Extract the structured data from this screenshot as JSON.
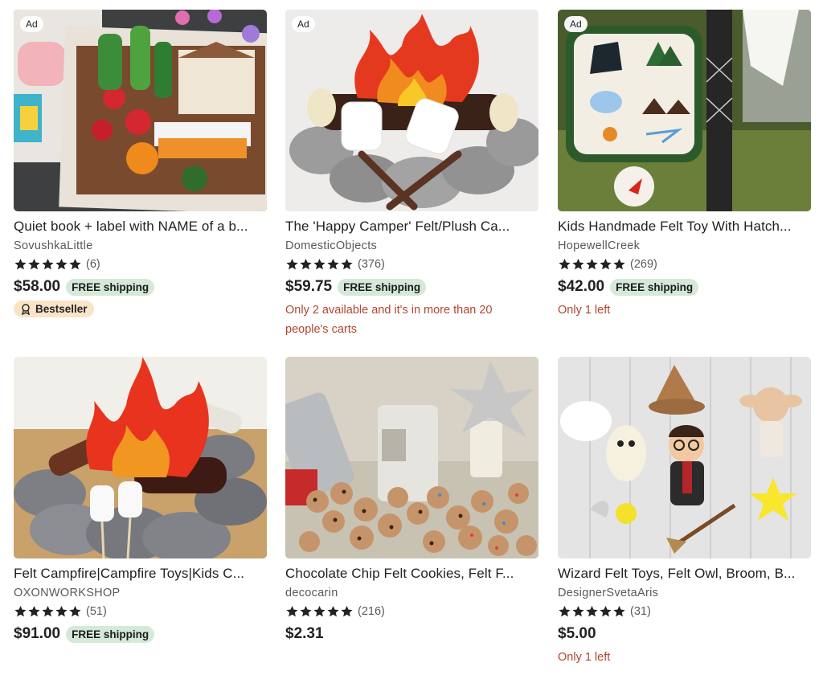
{
  "ad_label": "Ad",
  "colors": {
    "free_shipping_bg": "#d4e9d7",
    "bestseller_bg": "#f9e4c8",
    "urgency_text": "#b3462f"
  },
  "listings": [
    {
      "ad": true,
      "image": "felt-quiet-book-garden",
      "title": "Quiet book + label with NAME of a b...",
      "shop": "SovushkaLittle",
      "stars": 5,
      "review_count": "(6)",
      "price": "$58.00",
      "shipping": "FREE shipping",
      "badge": "Bestseller",
      "urgency": ""
    },
    {
      "ad": true,
      "image": "felt-campfire-marshmallows",
      "title": "The 'Happy Camper' Felt/Plush Ca...",
      "shop": "DomesticObjects",
      "stars": 5,
      "review_count": "(376)",
      "price": "$59.75",
      "shipping": "FREE shipping",
      "badge": "",
      "urgency": "Only 2 available and it's in more than 20 people's carts"
    },
    {
      "ad": true,
      "image": "felt-map-and-hatchet",
      "title": "Kids Handmade Felt Toy With Hatch...",
      "shop": "HopewellCreek",
      "stars": 5,
      "review_count": "(269)",
      "price": "$42.00",
      "shipping": "FREE shipping",
      "badge": "",
      "urgency": "Only 1 left"
    },
    {
      "ad": false,
      "image": "felt-campfire-logs-stones",
      "title": "Felt Campfire|Campfire Toys|Kids C...",
      "shop": "OXONWORKSHOP",
      "stars": 5,
      "review_count": "(51)",
      "price": "$91.00",
      "shipping": "FREE shipping",
      "badge": "",
      "urgency": ""
    },
    {
      "ad": false,
      "image": "felt-chocolate-chip-cookies",
      "title": "Chocolate Chip Felt Cookies, Felt F...",
      "shop": "decocarin",
      "stars": 5,
      "review_count": "(216)",
      "price": "$2.31",
      "shipping": "",
      "badge": "",
      "urgency": ""
    },
    {
      "ad": false,
      "image": "felt-wizard-toys",
      "title": "Wizard Felt Toys, Felt Owl, Broom, B...",
      "shop": "DesignerSvetaAris",
      "stars": 5,
      "review_count": "(31)",
      "price": "$5.00",
      "shipping": "",
      "badge": "",
      "urgency": "Only 1 left"
    }
  ]
}
